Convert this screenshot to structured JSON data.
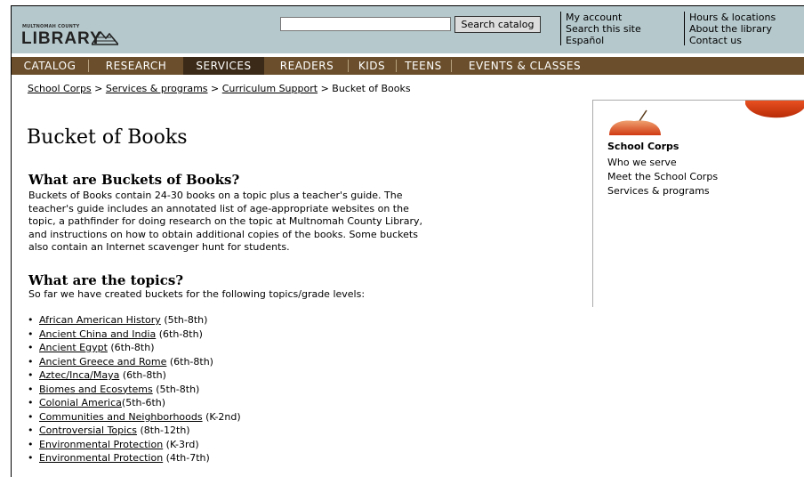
{
  "header": {
    "logo_small": "MULTNOMAH COUNTY",
    "logo_big": "LIBRARY",
    "search_value": "",
    "search_button": "Search catalog",
    "links_col1": [
      "My account",
      "Search this site",
      "Español"
    ],
    "links_col2": [
      "Hours & locations",
      "About the library",
      "Contact us"
    ]
  },
  "nav": {
    "items": [
      "CATALOG",
      "RESEARCH",
      "SERVICES",
      "READERS",
      "KIDS",
      "TEENS",
      "EVENTS & CLASSES"
    ],
    "active": "SERVICES"
  },
  "breadcrumb": {
    "links": [
      "School Corps",
      "Services & programs",
      "Curriculum Support"
    ],
    "separator": ">",
    "current": "Bucket of Books"
  },
  "main": {
    "title": "Bucket of Books",
    "section1_heading": "What are Buckets of Books?",
    "section1_lines": [
      "Buckets of Books contain 24-30 books on a topic plus a teacher's guide. The",
      "teacher's guide includes an annotated list of age-appropriate websites on the",
      "topic, a pathfinder for doing research on the topic at Multnomah County Library,",
      "and instructions on how to obtain additional copies of the books. Some buckets",
      "also contain an Internet scavenger hunt for students."
    ],
    "section2_heading": "What are the topics?",
    "section2_intro": "So far we have created buckets for the following topics/grade levels:",
    "topics": [
      {
        "name": "African American History",
        "grades": " (5th-8th)"
      },
      {
        "name": "Ancient China and India",
        "grades": " (6th-8th)"
      },
      {
        "name": "Ancient Egypt",
        "grades": " (6th-8th)"
      },
      {
        "name": "Ancient Greece and Rome",
        "grades": " (6th-8th)"
      },
      {
        "name": "Aztec/Inca/Maya",
        "grades": " (6th-8th)"
      },
      {
        "name": "Biomes and Ecosytems",
        "grades": " (5th-8th)"
      },
      {
        "name": "Colonial America",
        "grades": "(5th-6th)"
      },
      {
        "name": "Communities and Neighborhoods",
        "grades": " (K-2nd)"
      },
      {
        "name": "Controversial Topics",
        "grades": " (8th-12th)"
      },
      {
        "name": "Environmental Protection",
        "grades": " (K-3rd)"
      },
      {
        "name": "Environmental Protection",
        "grades": " (4th-7th)"
      }
    ]
  },
  "sidebar": {
    "title": "School Corps",
    "links": [
      "Who we serve",
      "Meet the School Corps",
      "Services & programs"
    ]
  },
  "colors": {
    "header_bg": "#b5c8cc",
    "nav_bg": "#6b4f2c",
    "nav_active_bg": "#3b2a17",
    "apple": "#d8451c"
  }
}
